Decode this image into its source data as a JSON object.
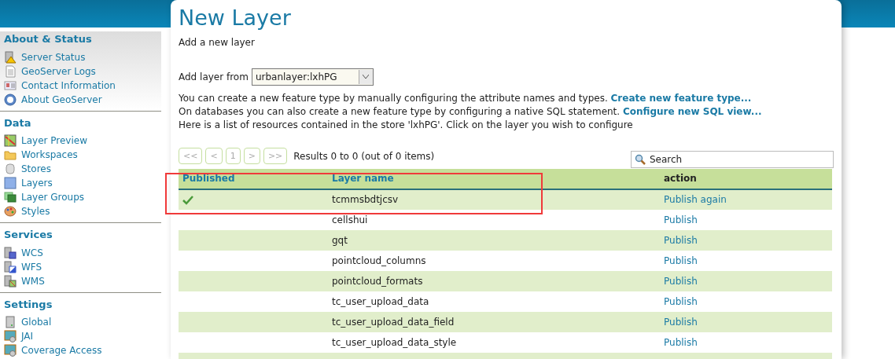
{
  "sidebar": {
    "sections": [
      {
        "title": "About & Status",
        "items": [
          {
            "label": "Server Status"
          },
          {
            "label": "GeoServer Logs"
          },
          {
            "label": "Contact Information"
          },
          {
            "label": "About GeoServer"
          }
        ]
      },
      {
        "title": "Data",
        "items": [
          {
            "label": "Layer Preview"
          },
          {
            "label": "Workspaces"
          },
          {
            "label": "Stores"
          },
          {
            "label": "Layers"
          },
          {
            "label": "Layer Groups"
          },
          {
            "label": "Styles"
          }
        ]
      },
      {
        "title": "Services",
        "items": [
          {
            "label": "WCS"
          },
          {
            "label": "WFS"
          },
          {
            "label": "WMS"
          }
        ]
      },
      {
        "title": "Settings",
        "items": [
          {
            "label": "Global"
          },
          {
            "label": "JAI"
          },
          {
            "label": "Coverage Access"
          }
        ]
      }
    ]
  },
  "page": {
    "title": "New Layer",
    "subtitle": "Add a new layer",
    "store_select": {
      "label": "Add layer from",
      "value": "urbanlayer:lxhPG"
    },
    "descriptions": [
      {
        "text": "You can create a new feature type by manually configuring the attribute names and types.",
        "link": "Create new feature type..."
      },
      {
        "text": "On databases you can also create a new feature type by configuring a native SQL statement.",
        "link": "Configure new SQL view..."
      },
      {
        "text": "Here is a list of resources contained in the store 'lxhPG'. Click on the layer you wish to configure"
      }
    ],
    "pager": {
      "buttons": [
        {
          "label": "<<",
          "disabled": true
        },
        {
          "label": "<",
          "disabled": true
        },
        {
          "label": "1",
          "disabled": true
        },
        {
          "label": ">",
          "disabled": true
        },
        {
          "label": ">>",
          "disabled": true
        }
      ],
      "results": "Results 0 to 0 (out of 0 items)"
    },
    "search": {
      "placeholder": "Search"
    },
    "table": {
      "columns": [
        {
          "label": "Published",
          "sortable": true
        },
        {
          "label": "Layer name",
          "sortable": true
        },
        {
          "label": "action",
          "sortable": false
        }
      ],
      "rows": [
        {
          "published": true,
          "layer_name": "tcmmsbdtjcsv",
          "action": "Publish again"
        },
        {
          "published": false,
          "layer_name": "cellshui",
          "action": "Publish"
        },
        {
          "published": false,
          "layer_name": "gqt",
          "action": "Publish"
        },
        {
          "published": false,
          "layer_name": "pointcloud_columns",
          "action": "Publish"
        },
        {
          "published": false,
          "layer_name": "pointcloud_formats",
          "action": "Publish"
        },
        {
          "published": false,
          "layer_name": "tc_user_upload_data",
          "action": "Publish"
        },
        {
          "published": false,
          "layer_name": "tc_user_upload_data_field",
          "action": "Publish"
        },
        {
          "published": false,
          "layer_name": "tc_user_upload_data_style",
          "action": "Publish"
        }
      ]
    }
  }
}
